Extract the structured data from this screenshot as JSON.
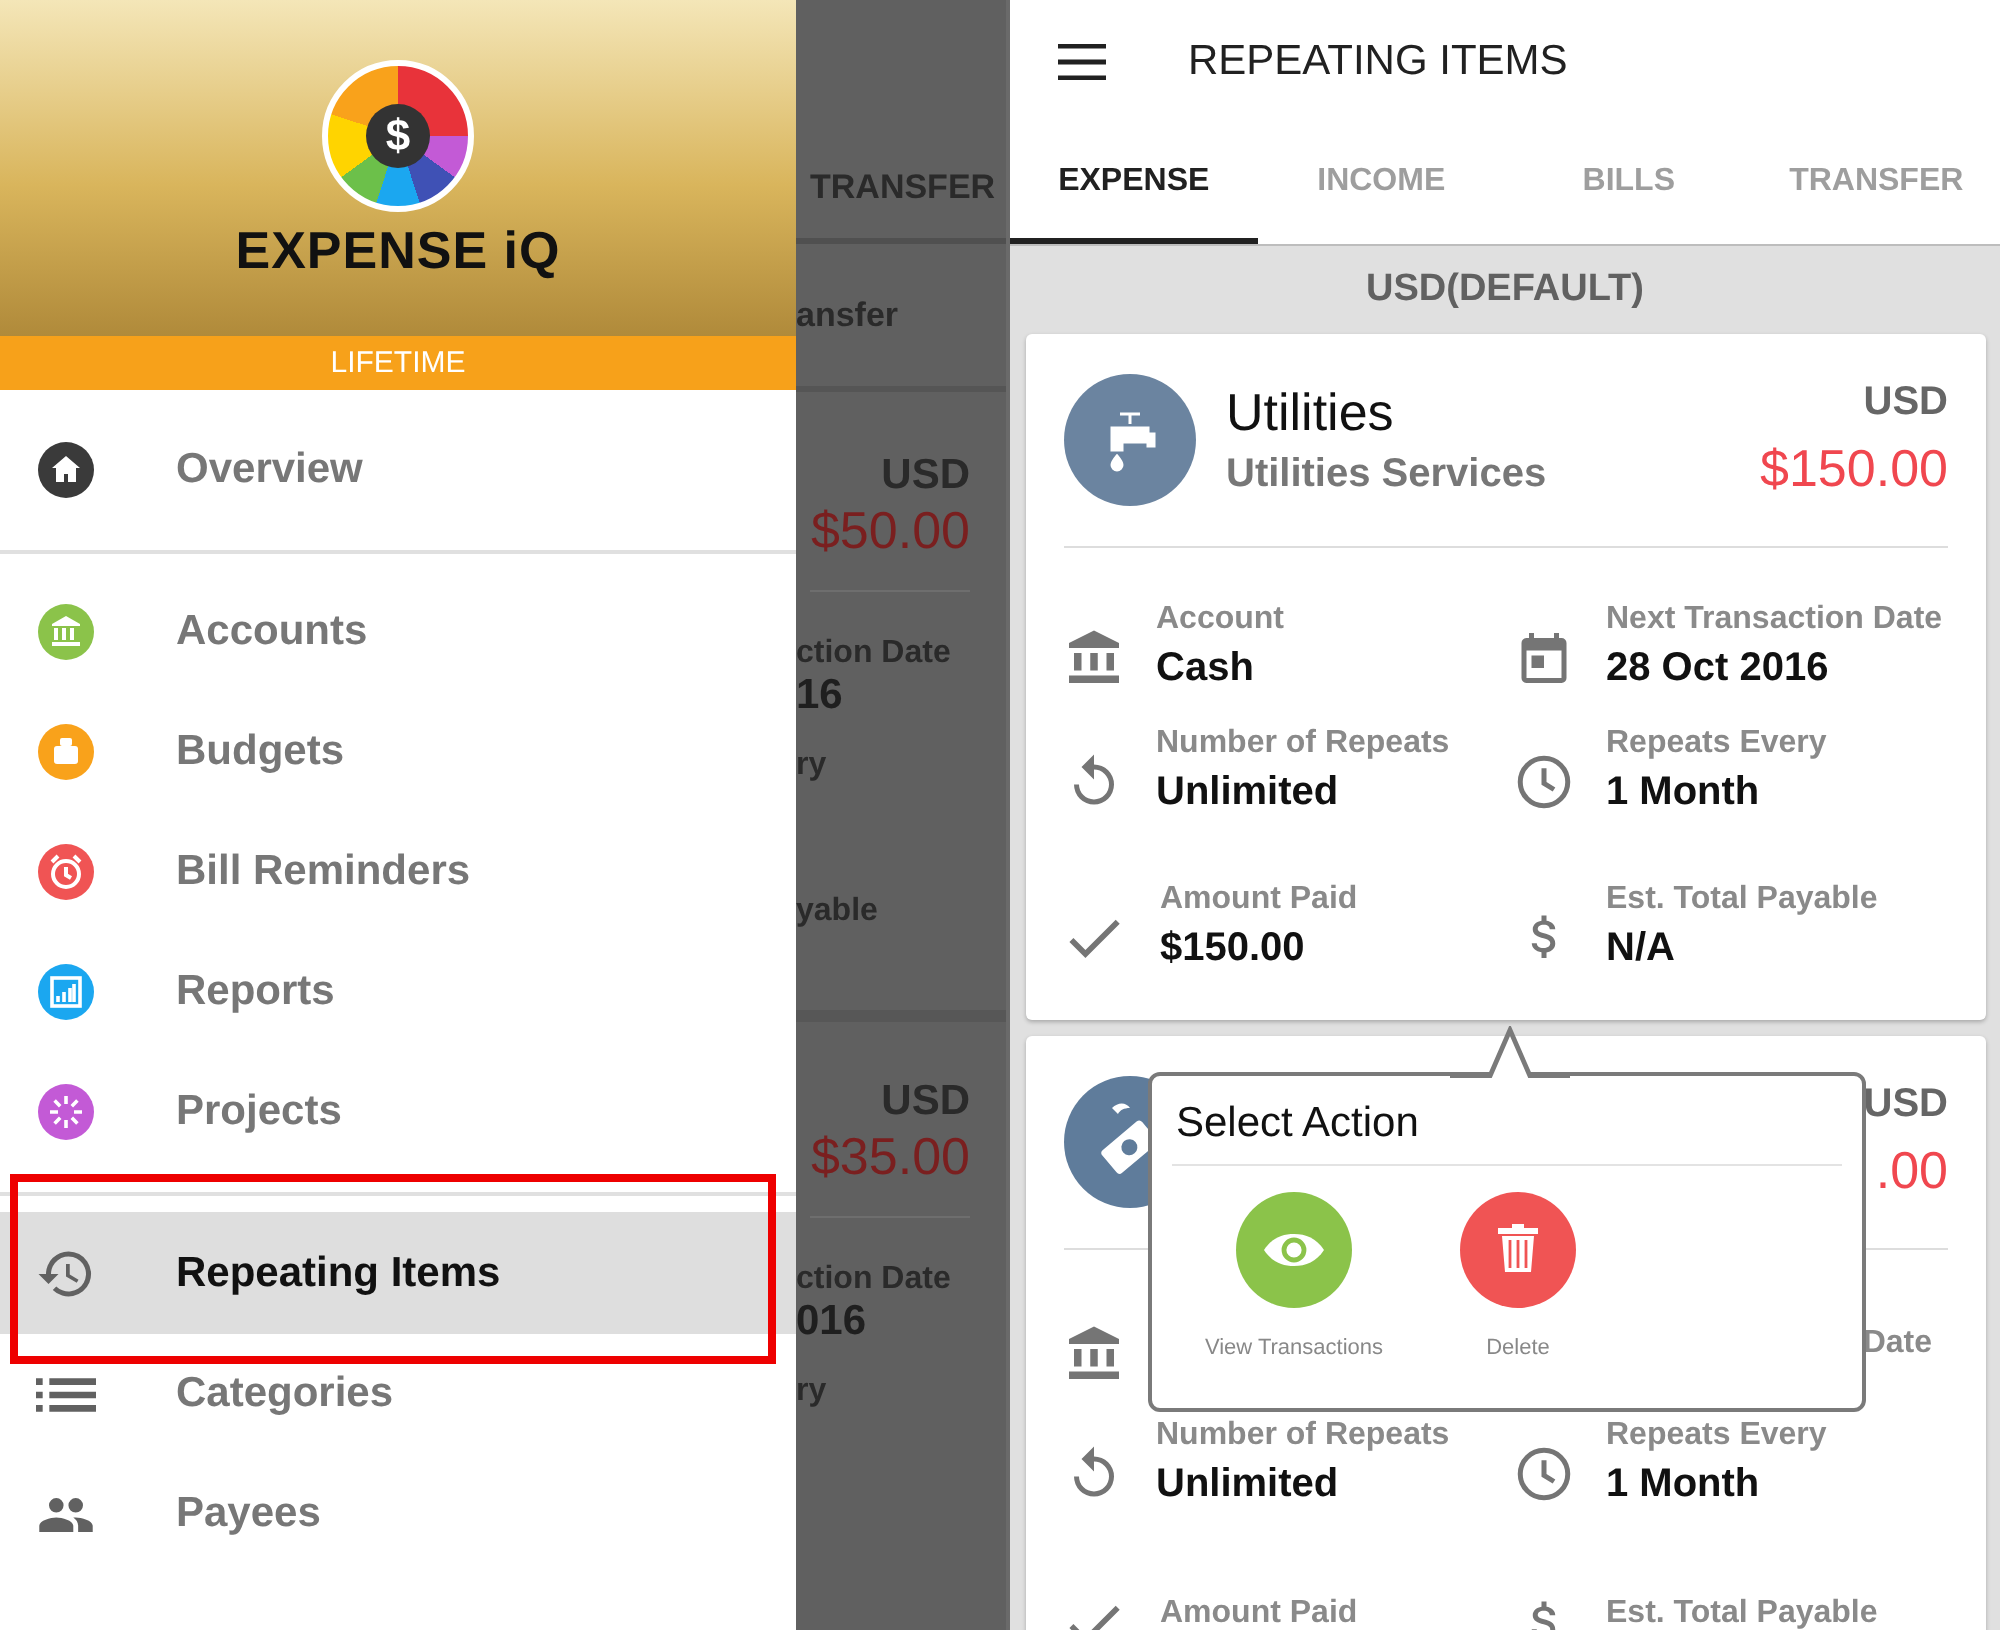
{
  "drawer": {
    "logo_symbol": "$",
    "brand": "EXPENSE iQ",
    "plan": "LIFETIME",
    "items": [
      {
        "label": "Overview",
        "selected": false,
        "color": "#3a3a3a"
      },
      {
        "label": "Accounts",
        "selected": false,
        "color": "#8bc34a"
      },
      {
        "label": "Budgets",
        "selected": false,
        "color": "#f9a21b"
      },
      {
        "label": "Bill Reminders",
        "selected": false,
        "color": "#f05454"
      },
      {
        "label": "Reports",
        "selected": false,
        "color": "#1ba7f0"
      },
      {
        "label": "Projects",
        "selected": false,
        "color": "#c35ad6"
      },
      {
        "label": "Repeating Items",
        "selected": true
      },
      {
        "label": "Categories",
        "selected": false
      },
      {
        "label": "Payees",
        "selected": false
      }
    ]
  },
  "background_screen": {
    "tab": "TRANSFER",
    "row": "ansfer",
    "cards": [
      {
        "currency": "USD",
        "amount": "$50.00",
        "lines": [
          "ction Date",
          "16",
          "ry",
          "yable"
        ]
      },
      {
        "currency": "USD",
        "amount": "$35.00",
        "lines": [
          "ction Date",
          "016",
          "ry"
        ]
      }
    ]
  },
  "app_bar": {
    "title": "REPEATING ITEMS"
  },
  "tabs": [
    {
      "label": "EXPENSE",
      "selected": true
    },
    {
      "label": "INCOME",
      "selected": false
    },
    {
      "label": "BILLS",
      "selected": false
    },
    {
      "label": "TRANSFER",
      "selected": false
    }
  ],
  "section_header": "USD(DEFAULT)",
  "cards": [
    {
      "title": "Utilities",
      "subtitle": "Utilities Services",
      "currency": "USD",
      "amount": "$150.00",
      "fields": [
        {
          "kind": "account",
          "label": "Account",
          "value": "Cash"
        },
        {
          "kind": "date",
          "label": "Next Transaction Date",
          "value": "28 Oct 2016"
        },
        {
          "kind": "repeats",
          "label": "Number of Repeats",
          "value": "Unlimited"
        },
        {
          "kind": "interval",
          "label": "Repeats Every",
          "value": "1 Month"
        },
        {
          "kind": "paid",
          "label": "Amount Paid",
          "value": "$150.00"
        },
        {
          "kind": "payable",
          "label": "Est. Total Payable",
          "value": "N/A"
        }
      ]
    },
    {
      "currency": "USD",
      "amount": ".00",
      "fields": [
        {
          "kind": "account"
        },
        {
          "kind": "date",
          "label": "Date",
          "label_cut": true
        },
        {
          "kind": "repeats",
          "label": "Number of Repeats",
          "value": "Unlimited"
        },
        {
          "kind": "interval",
          "label": "Repeats Every",
          "value": "1 Month"
        },
        {
          "kind": "paid",
          "label": "Amount Paid"
        },
        {
          "kind": "payable",
          "label": "Est. Total Payable"
        }
      ]
    }
  ],
  "popup": {
    "title": "Select Action",
    "actions": [
      {
        "label": "View Transactions",
        "kind": "view"
      },
      {
        "label": "Delete",
        "kind": "delete"
      }
    ]
  }
}
